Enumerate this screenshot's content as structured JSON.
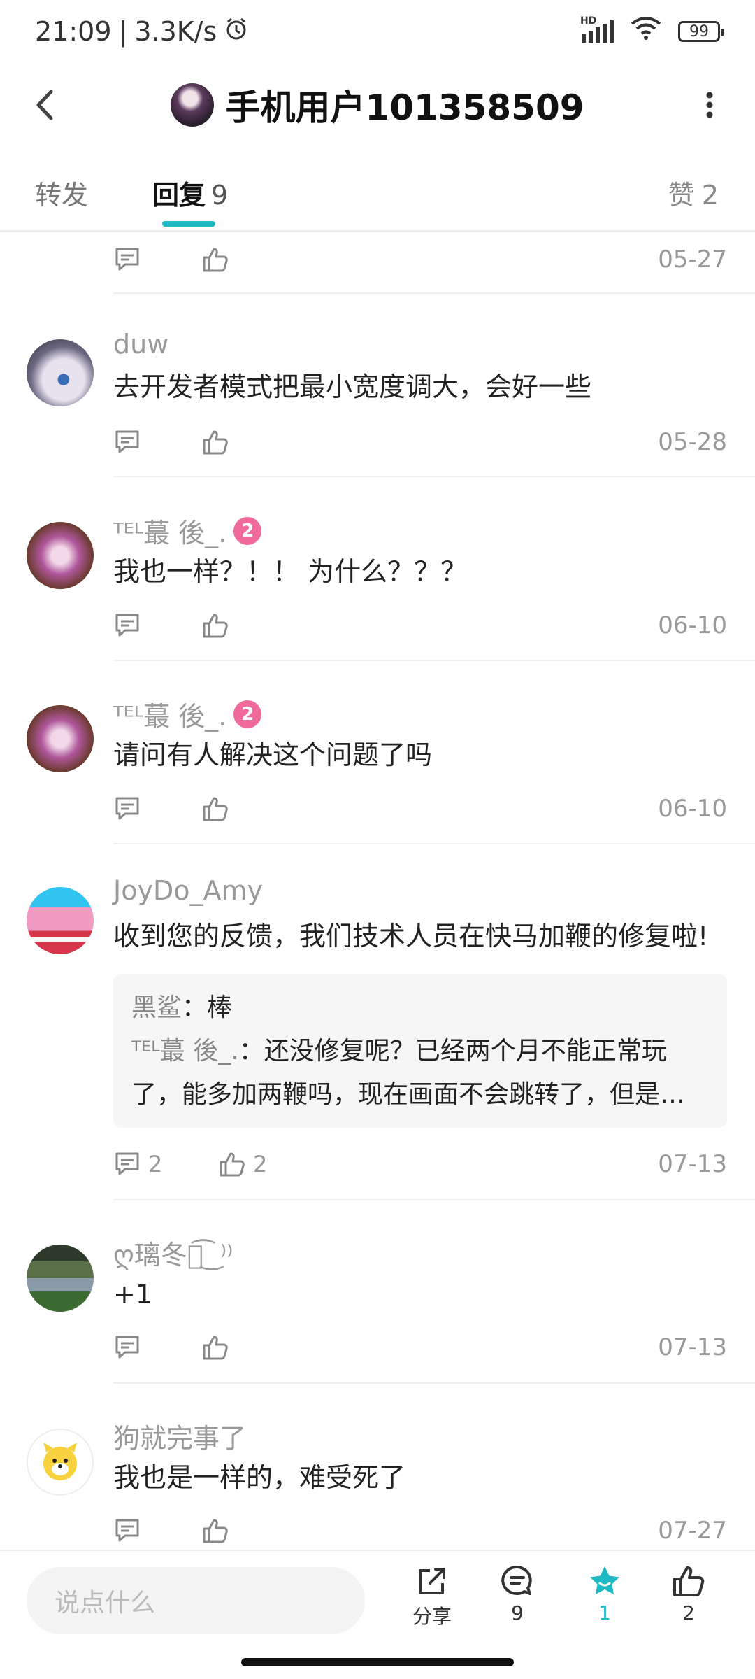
{
  "status_bar": {
    "time": "21:09",
    "speed": "3.3K/s",
    "network_label": "HD",
    "battery": "99"
  },
  "header": {
    "title": "手机用户101358509"
  },
  "tabs": {
    "forward": "转发",
    "reply_label": "回复",
    "reply_count": "9",
    "like_label": "赞",
    "like_count": "2"
  },
  "top_partial": {
    "date": "05-27"
  },
  "comments": [
    {
      "user": "duw",
      "text": "去开发者模式把最小宽度调大，会好一些",
      "date": "05-28"
    },
    {
      "user": "ᵀᴱᴸ蕞 後_.",
      "badge": "2",
      "text": "我也一样？！！ 为什么？？？",
      "date": "06-10"
    },
    {
      "user": "ᵀᴱᴸ蕞 後_.",
      "badge": "2",
      "text": "请问有人解决这个问题了吗",
      "date": "06-10"
    },
    {
      "user": "JoyDo_Amy",
      "text": "收到您的反馈，我们技术人员在快马加鞭的修复啦!",
      "quotes": [
        {
          "name": "黑鲨",
          "text": "棒"
        },
        {
          "name": "ᵀᴱᴸ蕞 後_.",
          "text": "还没修复呢？已经两个月不能正常玩"
        }
      ],
      "quote_more": "了，能多加两鞭吗，现在画面不会跳转了，但是…",
      "reply_count": "2",
      "like_count": "2",
      "date": "07-13"
    },
    {
      "user": "ღ璃冬ོ͡ ͜  ⁾⁾",
      "text": "+1",
      "date": "07-13"
    },
    {
      "user": "狗就完事了",
      "text": "我也是一样的，难受死了",
      "date": "07-27"
    }
  ],
  "bottom_bar": {
    "input_placeholder": "说点什么",
    "share_label": "分享",
    "comment_count": "9",
    "favorite_count": "1",
    "like_count": "2"
  },
  "colors": {
    "accent": "#1fb9c6",
    "badge": "#f06a9b"
  }
}
